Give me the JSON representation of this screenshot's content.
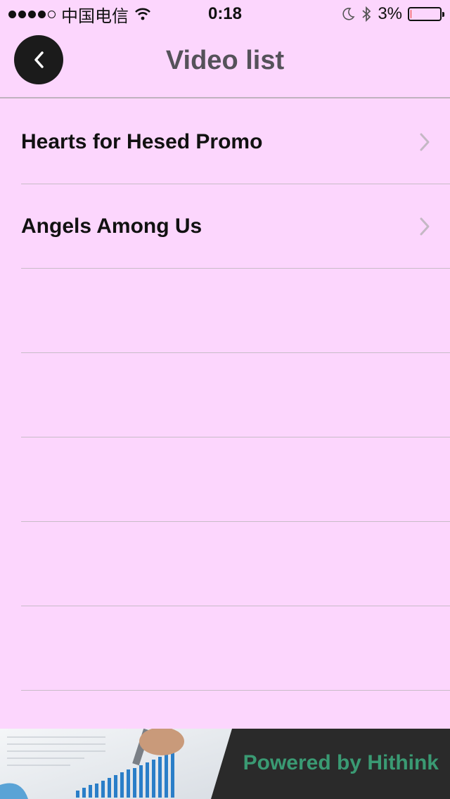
{
  "status_bar": {
    "carrier": "中国电信",
    "time": "0:18",
    "battery": "3%"
  },
  "header": {
    "title": "Video list"
  },
  "videos": [
    {
      "title": "Hearts for Hesed Promo"
    },
    {
      "title": "Angels Among Us"
    }
  ],
  "footer": {
    "powered_by": "Powered by Hithink"
  },
  "colors": {
    "background": "#fcd6fd",
    "title": "#55525a",
    "accent": "#3a9a73"
  }
}
